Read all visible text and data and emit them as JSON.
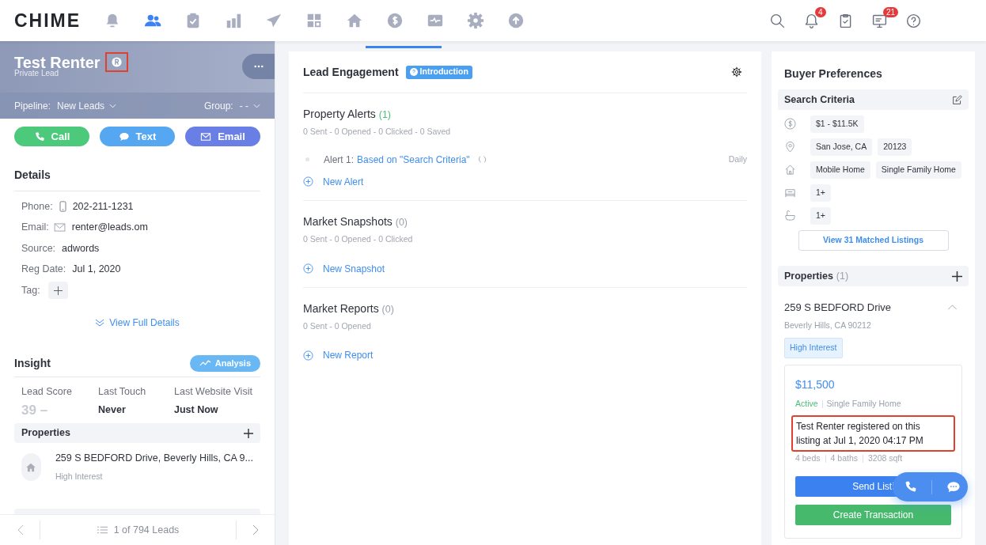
{
  "nav": {
    "logo": "CHIME",
    "items": [
      {
        "selected": false
      },
      {
        "selected": true
      },
      {
        "selected": false
      },
      {
        "selected": false
      },
      {
        "selected": false
      },
      {
        "selected": false
      },
      {
        "selected": false
      },
      {
        "selected": false
      },
      {
        "selected": false
      },
      {
        "selected": false
      },
      {
        "selected": false
      }
    ],
    "tools": [
      {
        "kind": "search"
      },
      {
        "kind": "bell",
        "badge": "4"
      },
      {
        "kind": "tasks"
      },
      {
        "kind": "messages",
        "badge": "21"
      },
      {
        "kind": "help"
      }
    ]
  },
  "lead": {
    "name": "Test Renter",
    "mark_highlighted": true,
    "subtitle": "Private Lead",
    "pipeline_label": "Pipeline:",
    "pipeline": "New Leads",
    "group_label": "Group:",
    "group": "- -",
    "actions": [
      {
        "kind": "call",
        "label": "Call"
      },
      {
        "kind": "text",
        "label": "Text"
      },
      {
        "kind": "email",
        "label": "Email"
      }
    ],
    "details": {
      "title": "Details",
      "fields": [
        {
          "kind": "phone",
          "label": "Phone:",
          "value": "202-211-1231"
        },
        {
          "kind": "email",
          "label": "Email:",
          "value": "renter@leads.om"
        },
        {
          "kind": "plain",
          "label": "Source:",
          "value": "adwords"
        },
        {
          "kind": "plain",
          "label": "Reg Date:",
          "value": "Jul 1, 2020"
        },
        {
          "kind": "tag",
          "label": "Tag:"
        }
      ],
      "more": "View Full Details"
    },
    "insight": {
      "title": "Insight",
      "button": "Analysis",
      "stats": [
        {
          "kind": "score",
          "label": "Lead Score",
          "value": "39 –"
        },
        {
          "kind": "plain",
          "label": "Last Touch",
          "value": "Never"
        },
        {
          "kind": "plain",
          "label": "Last Website Visit",
          "value": "Just Now"
        }
      ]
    },
    "properties": {
      "title": "Properties",
      "items": [
        {
          "address": "259 S BEDFORD Drive, Beverly Hills, CA 9...",
          "interest": "High Interest"
        }
      ]
    },
    "pager": "1 of 794 Leads"
  },
  "engagement": {
    "title": "Lead Engagement",
    "badge": "Introduction",
    "sections": [
      {
        "title": "Property Alerts",
        "count": "(1)",
        "highlighted": true,
        "stats": "0 Sent - 0 Opened - 0 Clicked - 0 Saved",
        "alerts": [
          {
            "label": "Alert 1:",
            "link": "Based on \"Search Criteria\"",
            "frequency": "Daily"
          }
        ],
        "action": "New Alert"
      },
      {
        "title": "Market Snapshots",
        "count": "(0)",
        "highlighted": false,
        "stats": "0 Sent - 0 Opened - 0 Clicked",
        "action": "New Snapshot"
      },
      {
        "title": "Market Reports",
        "count": "(0)",
        "highlighted": false,
        "stats": "0 Sent - 0 Opened",
        "action": "New Report"
      }
    ]
  },
  "buyer": {
    "title": "Buyer Preferences",
    "criteria_title": "Search Criteria",
    "criteria": [
      {
        "kind": "price",
        "chips": [
          "$1 - $11.5K"
        ]
      },
      {
        "kind": "location",
        "chips": [
          "San Jose, CA",
          "20123"
        ]
      },
      {
        "kind": "home",
        "chips": [
          "Mobile Home",
          "Single Family Home"
        ]
      },
      {
        "kind": "beds",
        "chips": [
          "1+"
        ]
      },
      {
        "kind": "baths",
        "chips": [
          "1+"
        ]
      }
    ],
    "matched_button": "View 31 Matched Listings",
    "properties_title": "Properties",
    "properties_count": "(1)",
    "property": {
      "street": "259 S BEDFORD Drive",
      "city": "Beverly Hills, CA 90212",
      "expanded": true,
      "interest": "High Interest",
      "price": "$11,500",
      "status": "Active",
      "type": "Single Family Home",
      "note": "Test Renter registered on this listing at Jul 1, 2020 04:17 PM",
      "note_highlighted": true,
      "facts": [
        "4 beds",
        "4 baths",
        "3208 sqft"
      ],
      "buttons": [
        {
          "kind": "primary",
          "label": "Send Listi"
        },
        {
          "kind": "success",
          "label": "Create Transaction"
        }
      ]
    }
  }
}
